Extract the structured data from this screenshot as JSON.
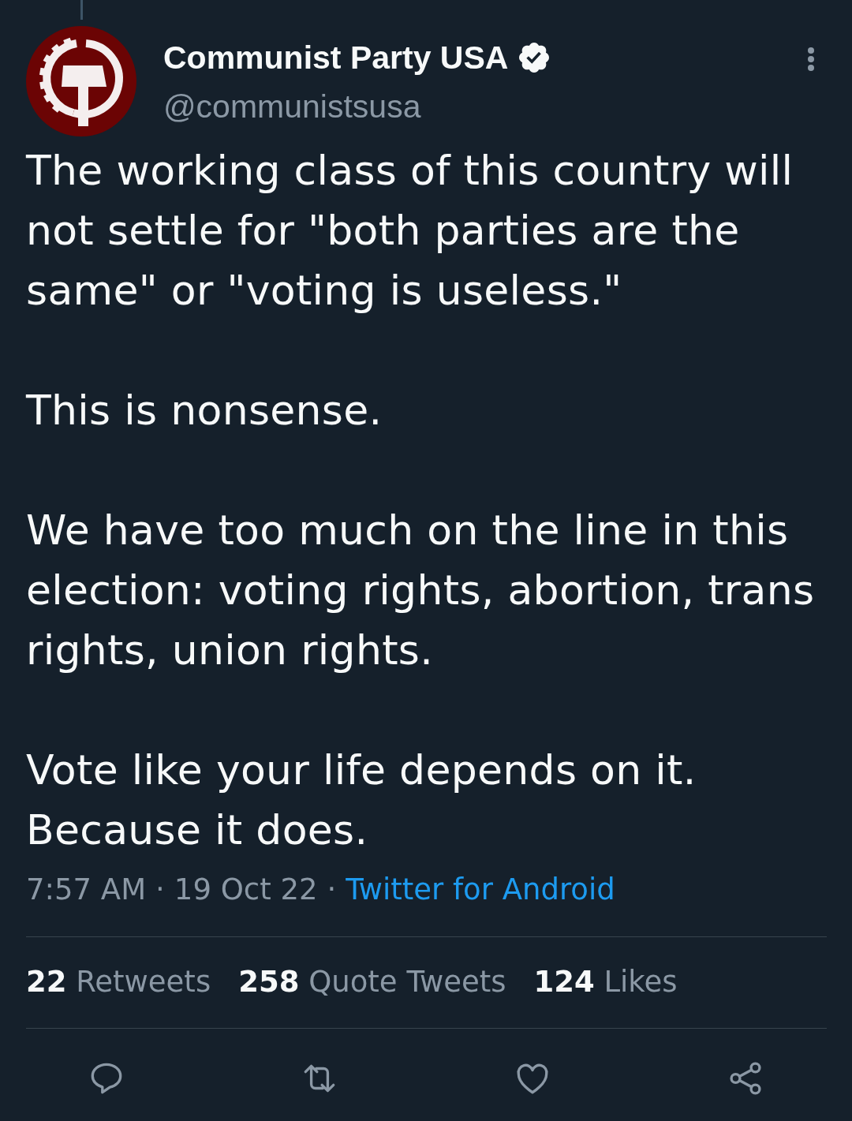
{
  "author": {
    "name": "Communist Party USA",
    "verified": true,
    "handle": "@communistsusa"
  },
  "tweet": {
    "paragraphs": [
      "The working class of this country will not settle for \"both parties are the same\" or \"voting is useless.\"",
      "This is nonsense.",
      "We have too much on the line in this election: voting rights, abortion, trans rights, union rights.",
      "Vote like your life depends on it. Because it does."
    ]
  },
  "meta": [
    {
      "kind": "time",
      "text": "7:57 AM"
    },
    {
      "kind": "separator",
      "text": "·"
    },
    {
      "kind": "date",
      "text": "19 Oct 22"
    },
    {
      "kind": "separator",
      "text": "·"
    },
    {
      "kind": "link",
      "text": "Twitter for Android"
    }
  ],
  "stats": [
    {
      "count": "22",
      "label": "Retweets"
    },
    {
      "count": "258",
      "label": "Quote Tweets"
    },
    {
      "count": "124",
      "label": "Likes"
    }
  ],
  "actions": [
    {
      "kind": "reply"
    },
    {
      "kind": "retweet"
    },
    {
      "kind": "like"
    },
    {
      "kind": "share"
    }
  ]
}
